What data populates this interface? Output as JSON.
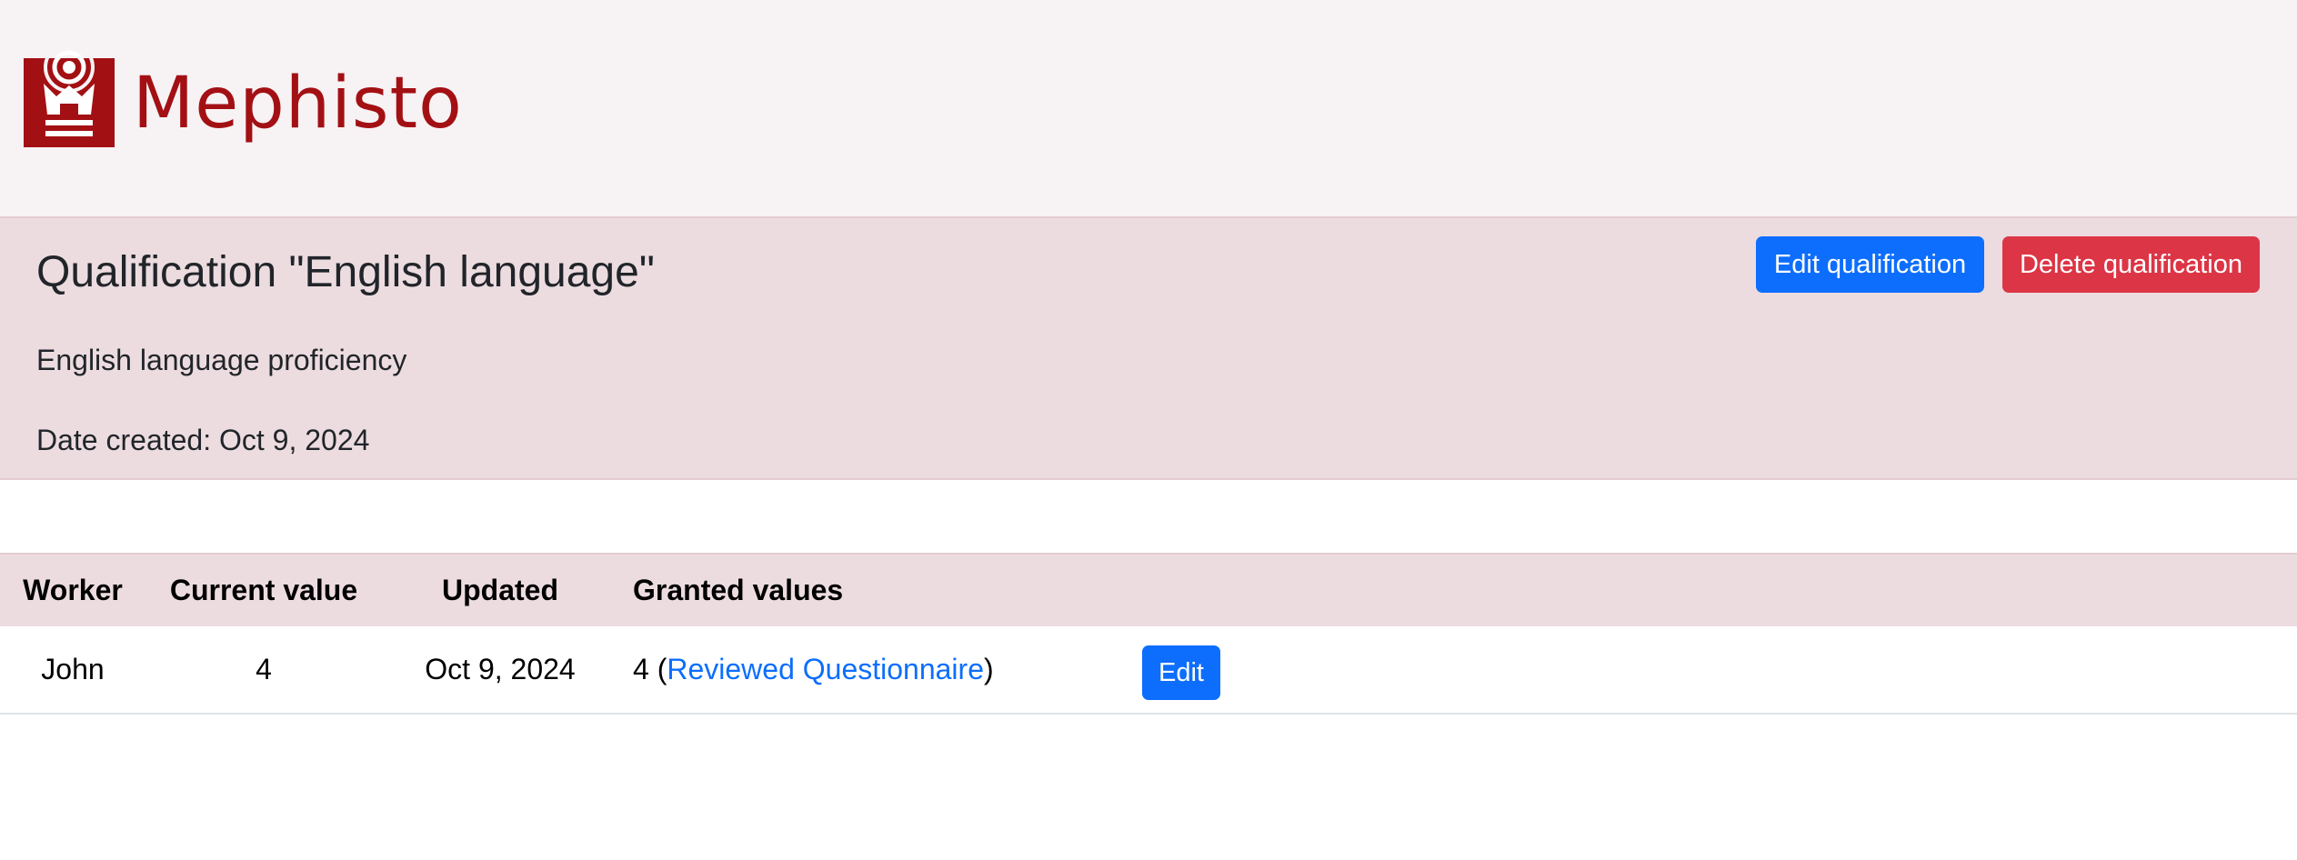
{
  "brand": {
    "name": "Mephisto",
    "color": "#a31014",
    "logo_icon": "crown-broadcast-icon"
  },
  "qualification": {
    "title": "Qualification \"English language\"",
    "description": "English language proficiency",
    "date_created": "Date created: Oct 9, 2024",
    "edit_label": "Edit qualification",
    "delete_label": "Delete qualification"
  },
  "table": {
    "headers": {
      "worker": "Worker",
      "current_value": "Current value",
      "updated": "Updated",
      "granted_values": "Granted values"
    },
    "rows": [
      {
        "worker": "John",
        "current_value": "4",
        "updated": "Oct 9, 2024",
        "granted_value": "4",
        "granted_paren_open": " (",
        "granted_link": "Reviewed Questionnaire",
        "granted_paren_close": ")",
        "edit_label": "Edit"
      }
    ]
  },
  "colors": {
    "header_bg": "#f7f2f4",
    "panel_bg": "#ecdce0",
    "primary": "#0d6efd",
    "danger": "#dc3545"
  }
}
